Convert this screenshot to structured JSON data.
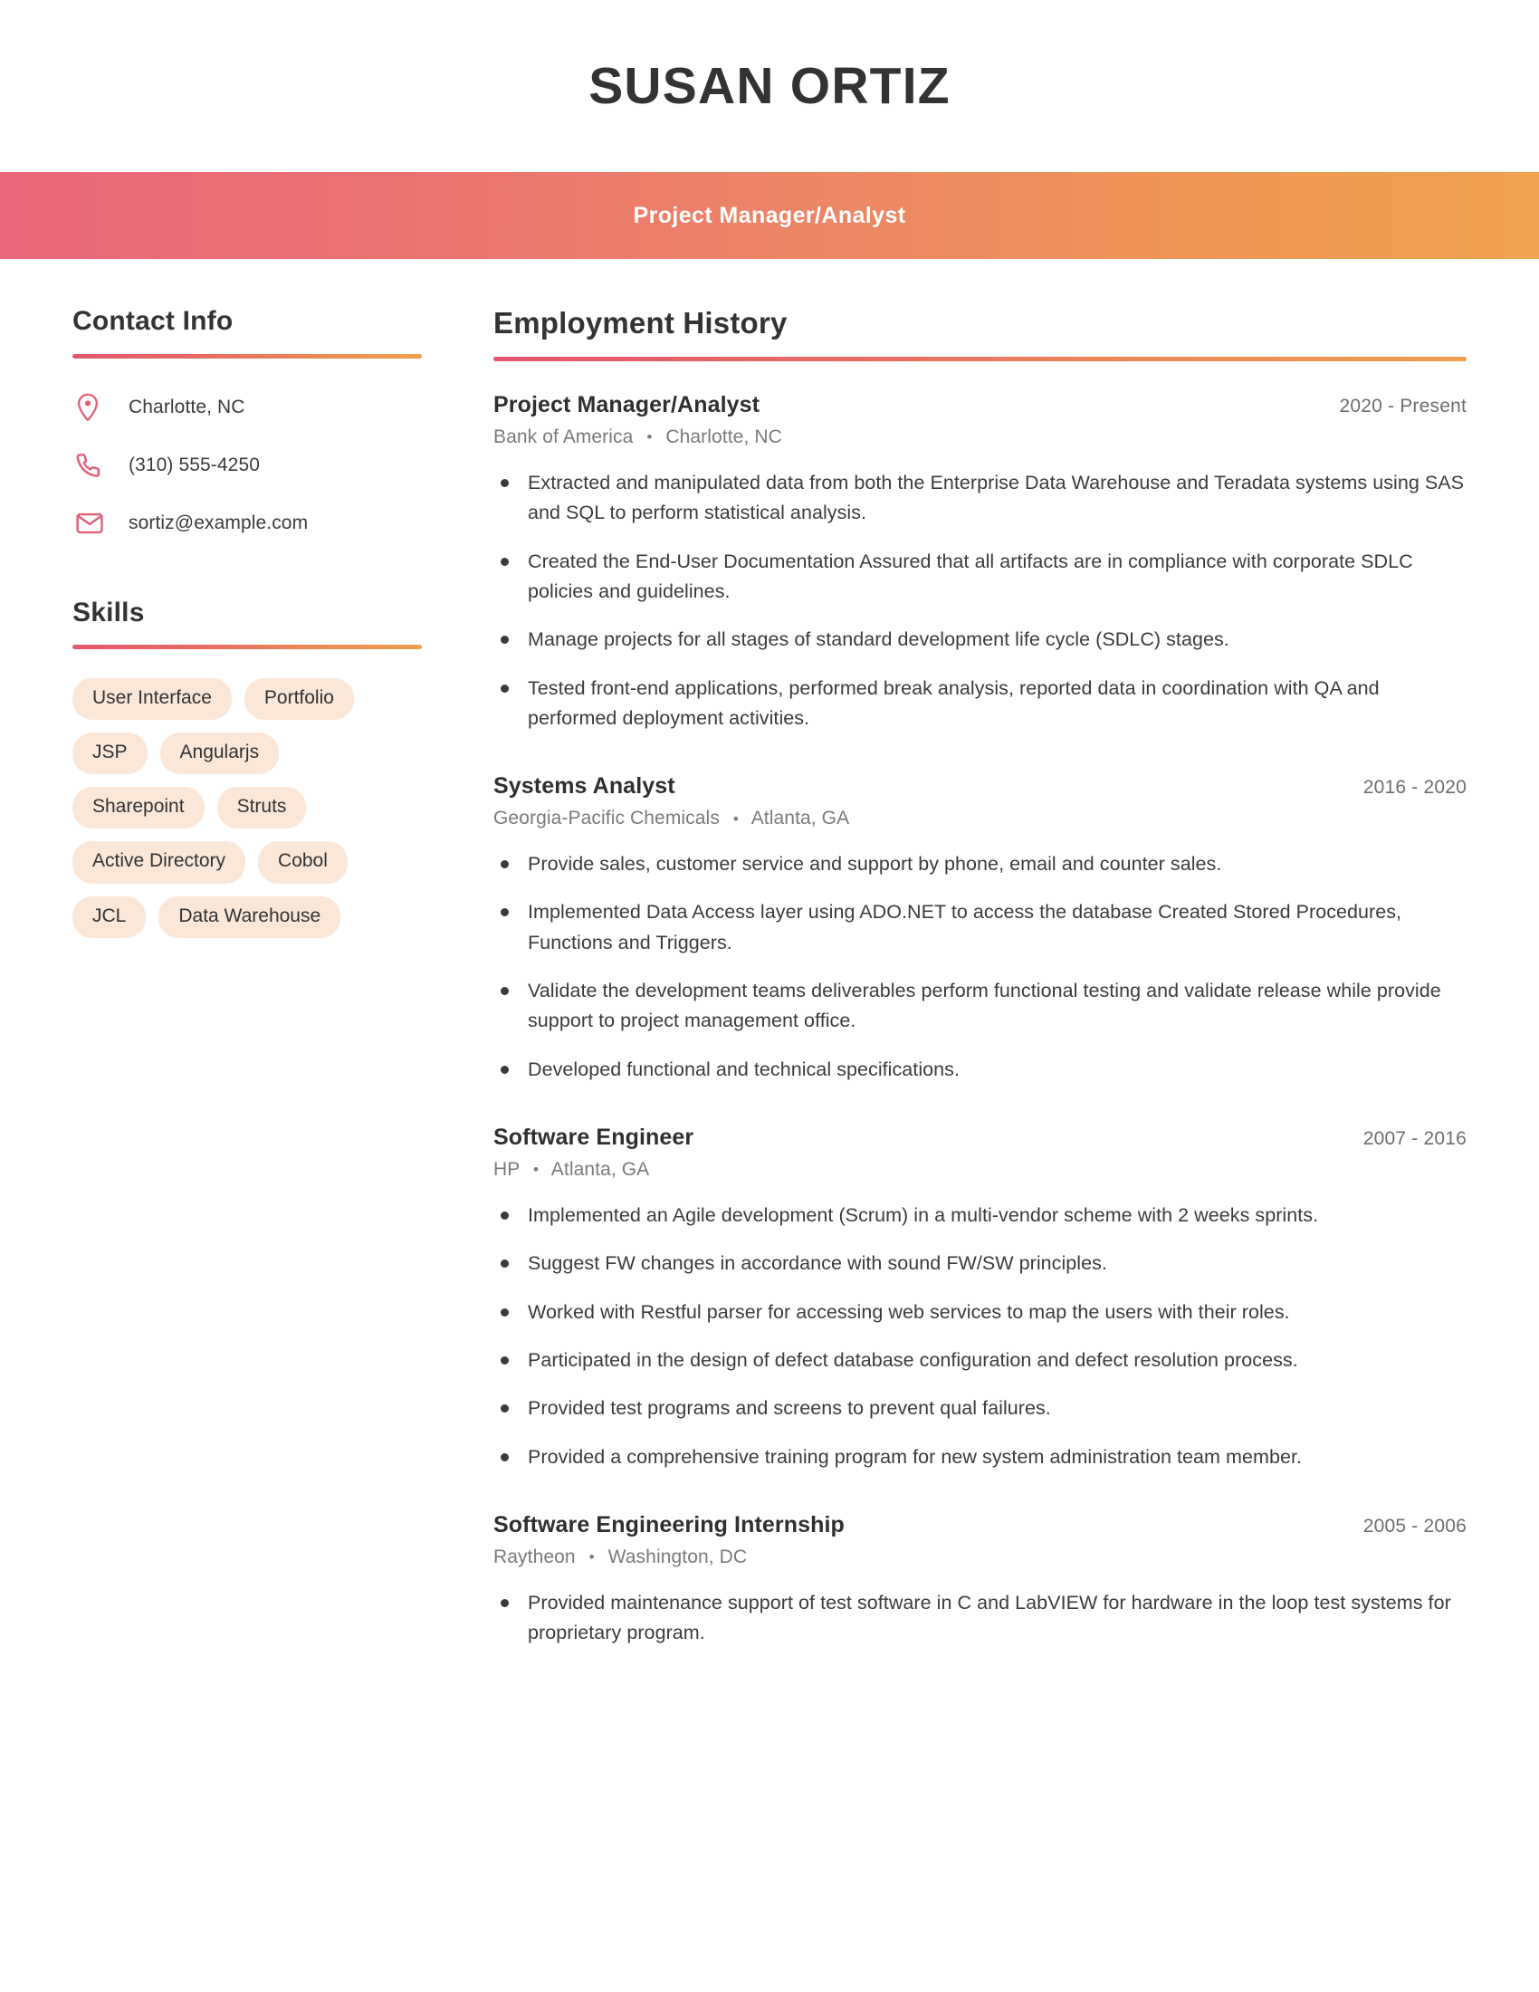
{
  "header": {
    "full_name": "SUSAN ORTIZ",
    "job_title": "Project Manager/Analyst",
    "accent_start": "#e8667b",
    "accent_end": "#eea24f"
  },
  "sidebar": {
    "contact": {
      "heading": "Contact Info",
      "items": [
        {
          "icon": "location-pin-icon",
          "value": "Charlotte, NC"
        },
        {
          "icon": "phone-icon",
          "value": "(310) 555-4250"
        },
        {
          "icon": "envelope-icon",
          "value": "sortiz@example.com"
        }
      ]
    },
    "skills": {
      "heading": "Skills",
      "tag_background": "#fbe7d8",
      "items": [
        "User Interface",
        "Portfolio",
        "JSP",
        "Angularjs",
        "Sharepoint",
        "Struts",
        "Active Directory",
        "Cobol",
        "JCL",
        "Data Warehouse"
      ]
    }
  },
  "main": {
    "heading": "Employment History",
    "separator": "•",
    "jobs": [
      {
        "role": "Project Manager/Analyst",
        "dates": "2020 - Present",
        "company": "Bank of America",
        "location": "Charlotte, NC",
        "bullets": [
          "Extracted and manipulated data from both the Enterprise Data Warehouse and Teradata systems using SAS and SQL to perform statistical analysis.",
          "Created the End-User Documentation Assured that all artifacts are in compliance with corporate SDLC policies and guidelines.",
          "Manage projects for all stages of standard development life cycle (SDLC) stages.",
          "Tested front-end applications, performed break analysis, reported data in coordination with QA and performed deployment activities."
        ]
      },
      {
        "role": "Systems Analyst",
        "dates": "2016 - 2020",
        "company": "Georgia-Pacific Chemicals",
        "location": "Atlanta, GA",
        "bullets": [
          "Provide sales, customer service and support by phone, email and counter sales.",
          "Implemented Data Access layer using ADO.NET to access the database Created Stored Procedures, Functions and Triggers.",
          "Validate the development teams deliverables perform functional testing and validate release while provide support to project management office.",
          "Developed functional and technical specifications."
        ]
      },
      {
        "role": "Software Engineer",
        "dates": "2007 - 2016",
        "company": "HP",
        "location": "Atlanta, GA",
        "bullets": [
          "Implemented an Agile development (Scrum) in a multi-vendor scheme with 2 weeks sprints.",
          "Suggest FW changes in accordance with sound FW/SW principles.",
          "Worked with Restful parser for accessing web services to map the users with their roles.",
          "Participated in the design of defect database configuration and defect resolution process.",
          "Provided test programs and screens to prevent qual failures.",
          "Provided a comprehensive training program for new system administration team member."
        ]
      },
      {
        "role": "Software Engineering Internship",
        "dates": "2005 - 2006",
        "company": "Raytheon",
        "location": "Washington, DC",
        "bullets": [
          "Provided maintenance support of test software in C and LabVIEW for hardware in the loop test systems for proprietary program."
        ]
      }
    ]
  }
}
